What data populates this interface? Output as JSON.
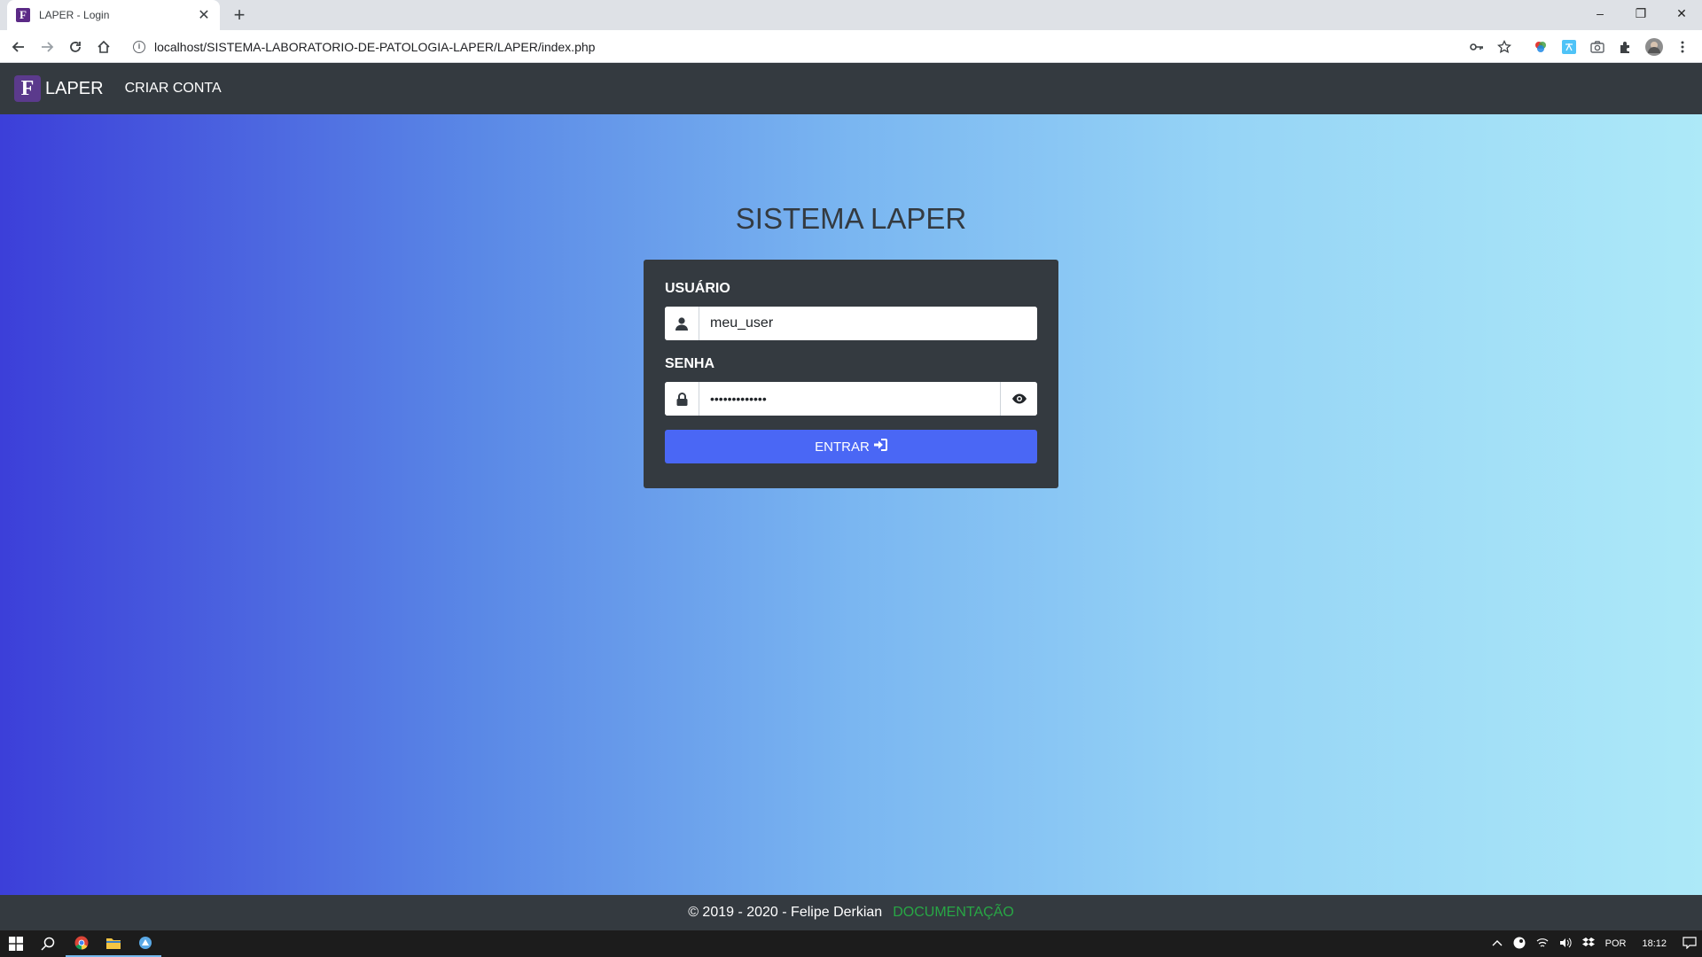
{
  "browser": {
    "tab_title": "LAPER - Login",
    "tab_close": "✕",
    "new_tab": "+",
    "url": "localhost/SISTEMA-LABORATORIO-DE-PATOLOGIA-LAPER/LAPER/index.php",
    "favicon_letter": "F",
    "window_controls": {
      "minimize": "–",
      "restore": "❐",
      "close": "✕"
    }
  },
  "navbar": {
    "brand_logo_letter": "F",
    "brand": "LAPER",
    "link_create_account": "CRIAR CONTA"
  },
  "main": {
    "title": "SISTEMA LAPER",
    "user_label": "USUÁRIO",
    "user_value": "meu_user",
    "password_label": "SENHA",
    "password_value": "*************",
    "submit_label": "ENTRAR"
  },
  "footer": {
    "copyright": "© 2019 - 2020 - Felipe Derkian",
    "docs_link": "DOCUMENTAÇÃO"
  },
  "taskbar": {
    "language": "POR",
    "time": "18:12"
  },
  "colors": {
    "navbar_bg": "#343a40",
    "button_primary": "#4a67f5",
    "docs_link": "#28a745",
    "gradient_start": "#3c3fd9",
    "gradient_end": "#ade9f8"
  }
}
